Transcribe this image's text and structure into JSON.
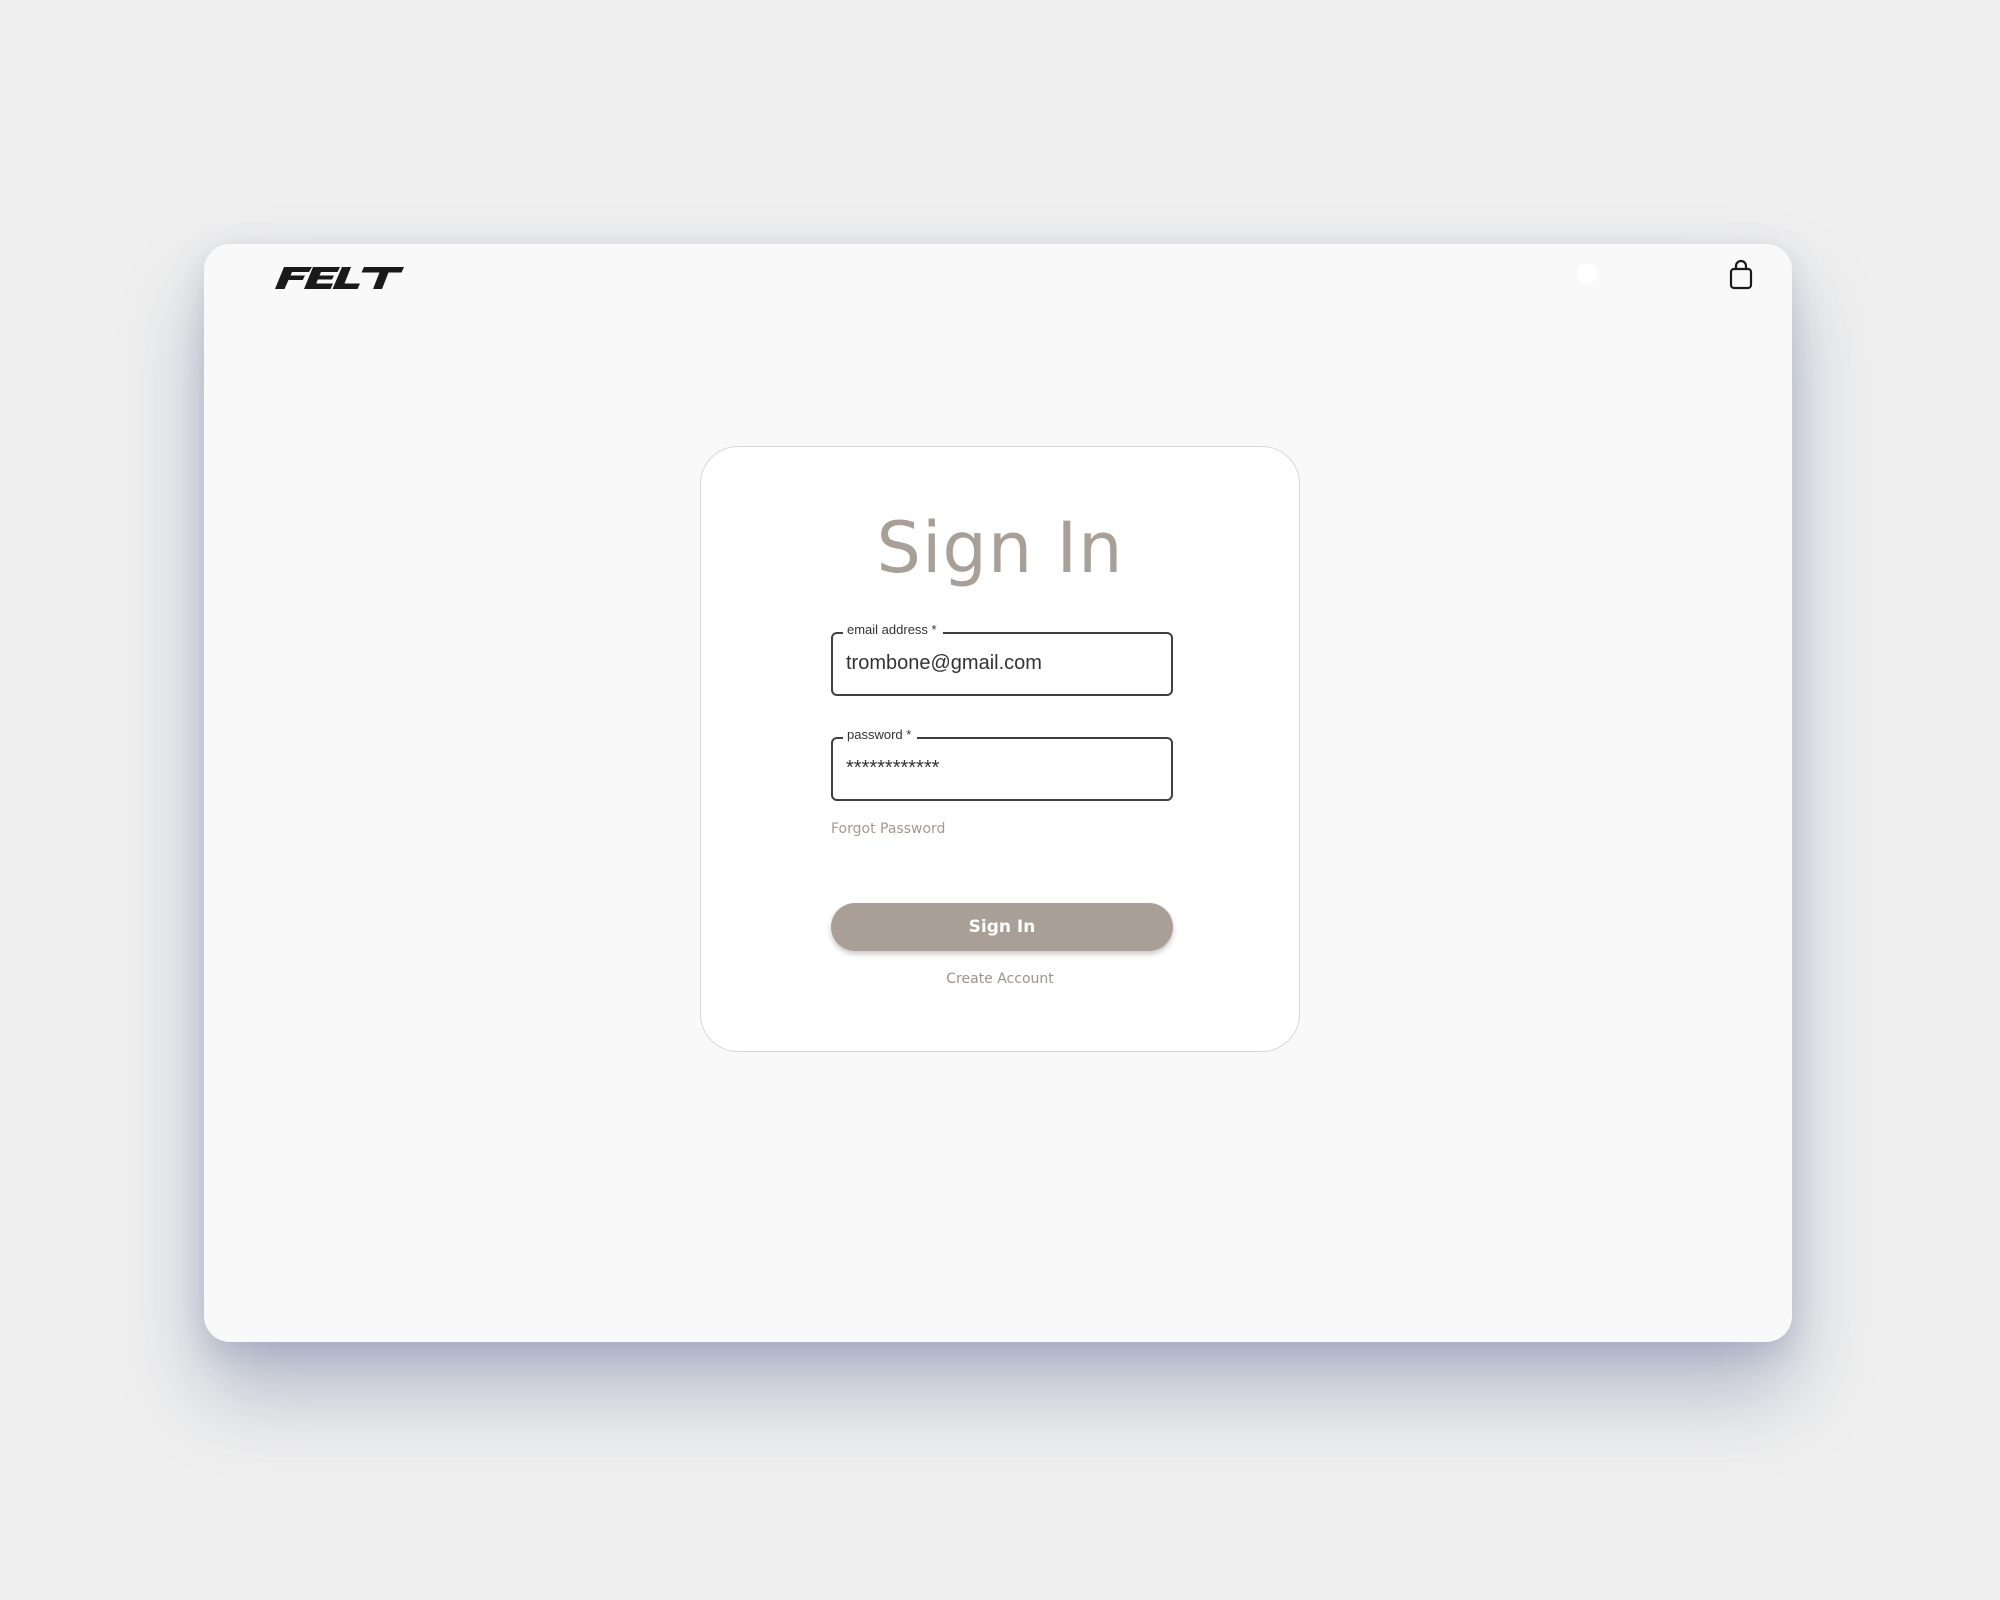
{
  "header": {
    "logo_text": "FELT",
    "cart_icon": "shopping-bag-icon"
  },
  "signin": {
    "title": "Sign In",
    "email": {
      "label": "email address *",
      "value": "trombone@gmail.com"
    },
    "password": {
      "label": "password *",
      "value": "************"
    },
    "forgot_label": "Forgot Password",
    "submit_label": "Sign In",
    "create_label": "Create Account"
  },
  "colors": {
    "accent": "#aa9f97",
    "title": "#a89f97",
    "background": "#efefef",
    "window": "#f9f9f9"
  }
}
